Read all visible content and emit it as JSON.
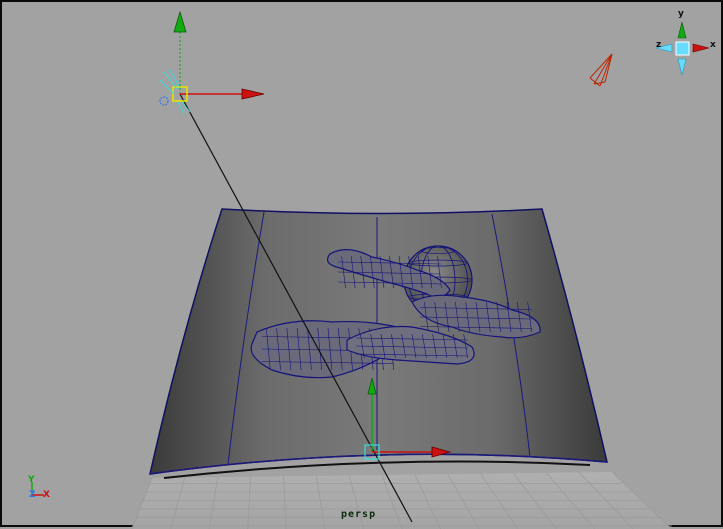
{
  "viewport": {
    "camera_name": "persp",
    "background_color": "#a2a2a2",
    "border_color": "#0a0a0a"
  },
  "view_cube": {
    "y_label": "y",
    "z_label": "z",
    "x_label": "x"
  },
  "axis_indicator": {
    "y_label": "Y",
    "z_label": "Z",
    "x_label": "X"
  },
  "colors": {
    "x_axis": "#cc1111",
    "y_axis": "#11aa11",
    "z_axis": "#3377ee",
    "wireframe": "#14147a",
    "grid": "#9c9c9c",
    "selection": "#e6e600"
  }
}
